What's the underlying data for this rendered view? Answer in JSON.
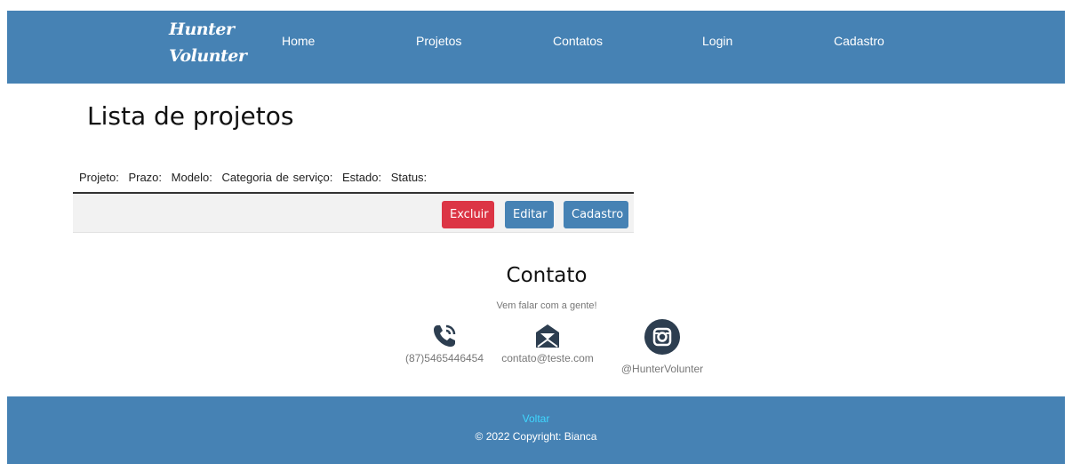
{
  "navbar": {
    "brand_line1": "Hunter",
    "brand_line2": "Volunter",
    "links": [
      "Home",
      "Projetos",
      "Contatos",
      "Login",
      "Cadastro"
    ]
  },
  "page": {
    "title": "Lista de projetos"
  },
  "table": {
    "columns": [
      "Projeto:",
      "Prazo:",
      "Modelo:",
      "Categoria de serviço:",
      "Estado:",
      "Status:"
    ],
    "buttons": {
      "delete": "Excluir",
      "edit": "Editar",
      "register": "Cadastro"
    }
  },
  "contact": {
    "title": "Contato",
    "subtitle": "Vem falar com a gente!",
    "phone": "(87)5465446454",
    "email": "contato@teste.com",
    "instagram": "@HunterVolunter"
  },
  "footer": {
    "back_link": "Voltar",
    "copyright": "© 2022 Copyright: Bianca"
  },
  "colors": {
    "primary": "#4682b4",
    "danger": "#dc3545",
    "icon": "#2d3e50",
    "footer_link": "#3fd7ff"
  },
  "icons": {
    "phone": "phone-icon",
    "email": "envelope-icon",
    "instagram": "instagram-icon"
  }
}
